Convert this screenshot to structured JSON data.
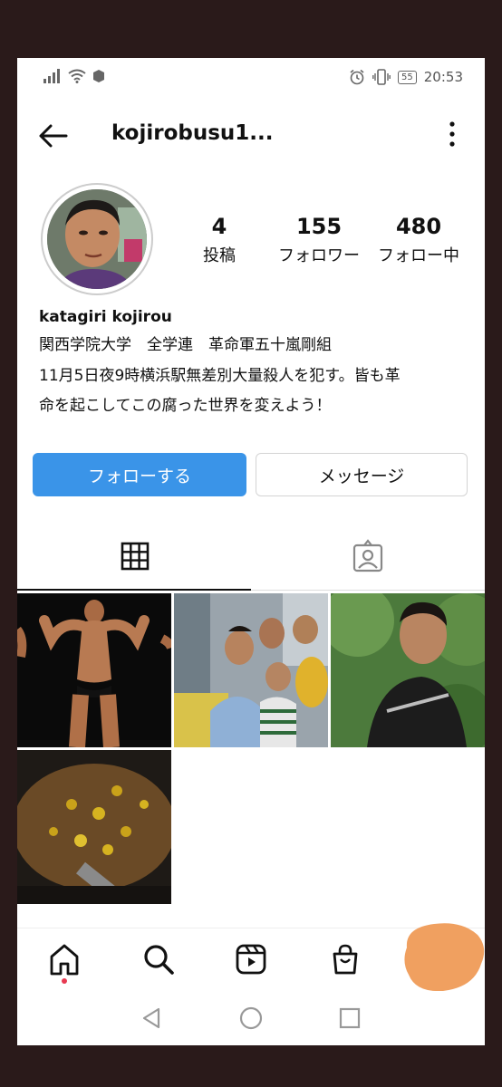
{
  "status_bar": {
    "time": "20:53",
    "battery": "55"
  },
  "header": {
    "username": "kojirobusu1..."
  },
  "profile": {
    "stats": [
      {
        "num": "4",
        "label": "投稿"
      },
      {
        "num": "155",
        "label": "フォロワー"
      },
      {
        "num": "480",
        "label": "フォロー中"
      }
    ],
    "name": "katagiri kojirou",
    "bio": [
      "関西学院大学　全学連　革命軍五十嵐剛組",
      "11月5日夜9時横浜駅無差別大量殺人を犯す。皆も革",
      "命を起こしてこの腐った世界を変えよう！"
    ]
  },
  "actions": {
    "follow": "フォローする",
    "message": "メッセージ"
  },
  "colors": {
    "accent": "#3a94e8",
    "notification_dot": "#e83a52",
    "redaction": "#f0a060"
  }
}
